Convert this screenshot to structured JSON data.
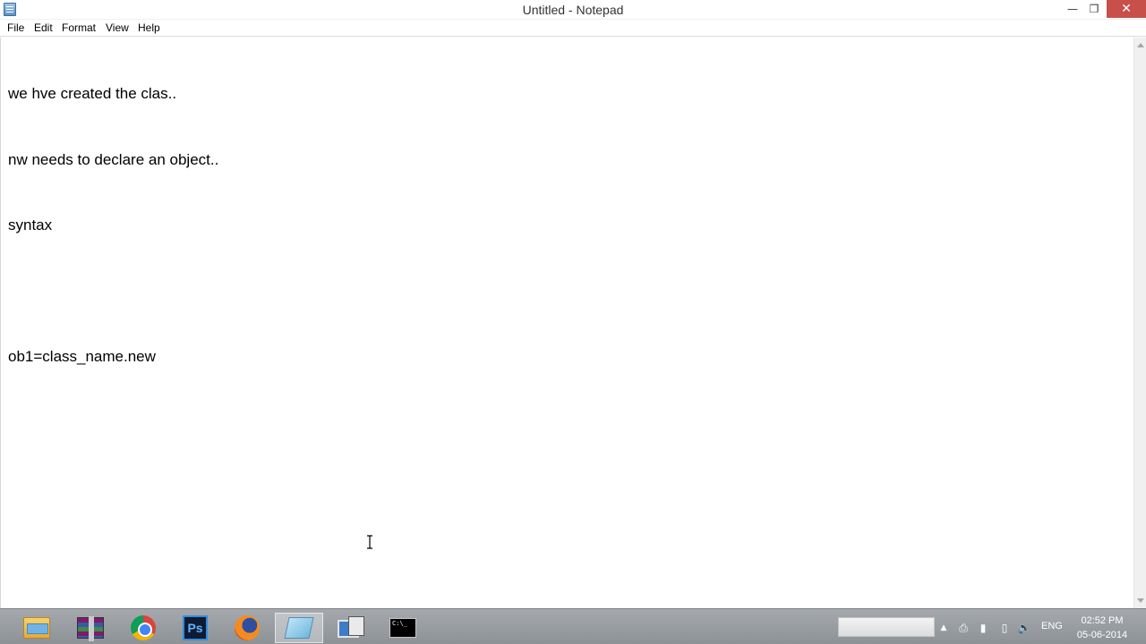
{
  "window": {
    "title": "Untitled - Notepad",
    "controls": {
      "minimize": "—",
      "maximize": "❐",
      "close": "✕"
    }
  },
  "menu": {
    "file": "File",
    "edit": "Edit",
    "format": "Format",
    "view": "View",
    "help": "Help"
  },
  "editor": {
    "lines": [
      "we hve created the clas..",
      "nw needs to declare an object..",
      "syntax",
      "",
      "ob1=class_name.new"
    ]
  },
  "taskbar": {
    "apps": [
      {
        "name": "file-explorer-icon"
      },
      {
        "name": "winrar-icon"
      },
      {
        "name": "chrome-icon"
      },
      {
        "name": "photoshop-icon",
        "label": "Ps"
      },
      {
        "name": "firefox-icon"
      },
      {
        "name": "notepad-icon",
        "active": true
      },
      {
        "name": "remote-desktop-icon"
      },
      {
        "name": "command-prompt-icon",
        "label": "C:\\_"
      }
    ]
  },
  "tray": {
    "language": "ENG",
    "time": "02:52 PM",
    "date": "05-06-2014"
  },
  "colors": {
    "close_button": "#c7504a",
    "taskbar": "#9a9ea2"
  }
}
